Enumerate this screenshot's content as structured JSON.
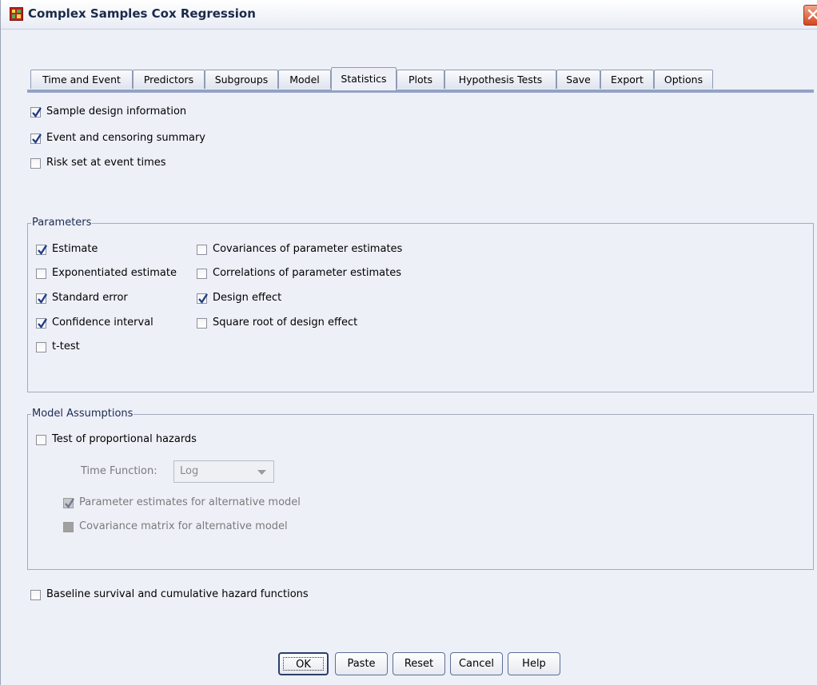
{
  "window": {
    "title": "Complex Samples Cox Regression"
  },
  "tabs": [
    {
      "label": "Time and Event"
    },
    {
      "label": "Predictors"
    },
    {
      "label": "Subgroups"
    },
    {
      "label": "Model"
    },
    {
      "label": "Statistics",
      "active": true
    },
    {
      "label": "Plots"
    },
    {
      "label": "Hypothesis Tests"
    },
    {
      "label": "Save"
    },
    {
      "label": "Export"
    },
    {
      "label": "Options"
    }
  ],
  "summary": {
    "sample_design": {
      "label": "Sample design information",
      "checked": true
    },
    "event_censoring": {
      "label": "Event and censoring summary",
      "checked": true
    },
    "risk_set": {
      "label": "Risk set at event times",
      "checked": false
    }
  },
  "parameters": {
    "title": "Parameters",
    "estimate": {
      "label": "Estimate",
      "checked": true
    },
    "exponentiated": {
      "label": "Exponentiated estimate",
      "checked": false
    },
    "std_error": {
      "label": "Standard error",
      "checked": true
    },
    "conf_interval": {
      "label": "Confidence interval",
      "checked": true
    },
    "t_test": {
      "label": "t-test",
      "checked": false
    },
    "covariances": {
      "label": "Covariances of parameter estimates",
      "checked": false
    },
    "correlations": {
      "label": "Correlations of parameter estimates",
      "checked": false
    },
    "design_effect": {
      "label": "Design effect",
      "checked": true
    },
    "sqrt_design_effect": {
      "label": "Square root of design effect",
      "checked": false
    }
  },
  "model_assumptions": {
    "title": "Model Assumptions",
    "prop_hazards": {
      "label": "Test of proportional hazards",
      "checked": false
    },
    "time_function_label": "Time Function:",
    "time_function_value": "Log",
    "alt_param_estimates": {
      "label": "Parameter estimates for alternative model",
      "checked": true,
      "enabled": false
    },
    "alt_cov_matrix": {
      "label": "Covariance matrix for alternative model",
      "checked": false,
      "enabled": false
    }
  },
  "baseline": {
    "label": "Baseline survival and cumulative hazard functions",
    "checked": false
  },
  "buttons": {
    "ok": "OK",
    "paste": "Paste",
    "reset": "Reset",
    "cancel": "Cancel",
    "help": "Help"
  },
  "colors": {
    "dialog_bg": "#eef0f8",
    "tab_rule": "#93a2c5",
    "checkmark": "#1d3f8a",
    "close_button": "#d3461f"
  }
}
